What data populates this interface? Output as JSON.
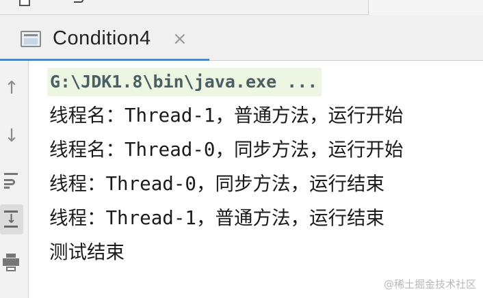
{
  "tab": {
    "label": "Condition4",
    "close_symbol": "×"
  },
  "gutter_icons": [
    "arrow-up-icon",
    "arrow-down-icon",
    "soft-wrap-icon",
    "scroll-to-end-icon",
    "print-icon"
  ],
  "console": {
    "command": "G:\\JDK1.8\\bin\\java.exe ...",
    "lines": [
      "线程名：Thread-1，普通方法，运行开始",
      "线程名：Thread-0，同步方法，运行开始",
      "线程：Thread-0，同步方法，运行结束",
      "线程：Thread-1，普通方法，运行结束",
      "测试结束"
    ]
  },
  "watermark": "@稀土掘金技术社区",
  "colors": {
    "tab_underline": "#4a88c7",
    "command_highlight": "#edf6e3",
    "command_text": "#4b5e63"
  }
}
